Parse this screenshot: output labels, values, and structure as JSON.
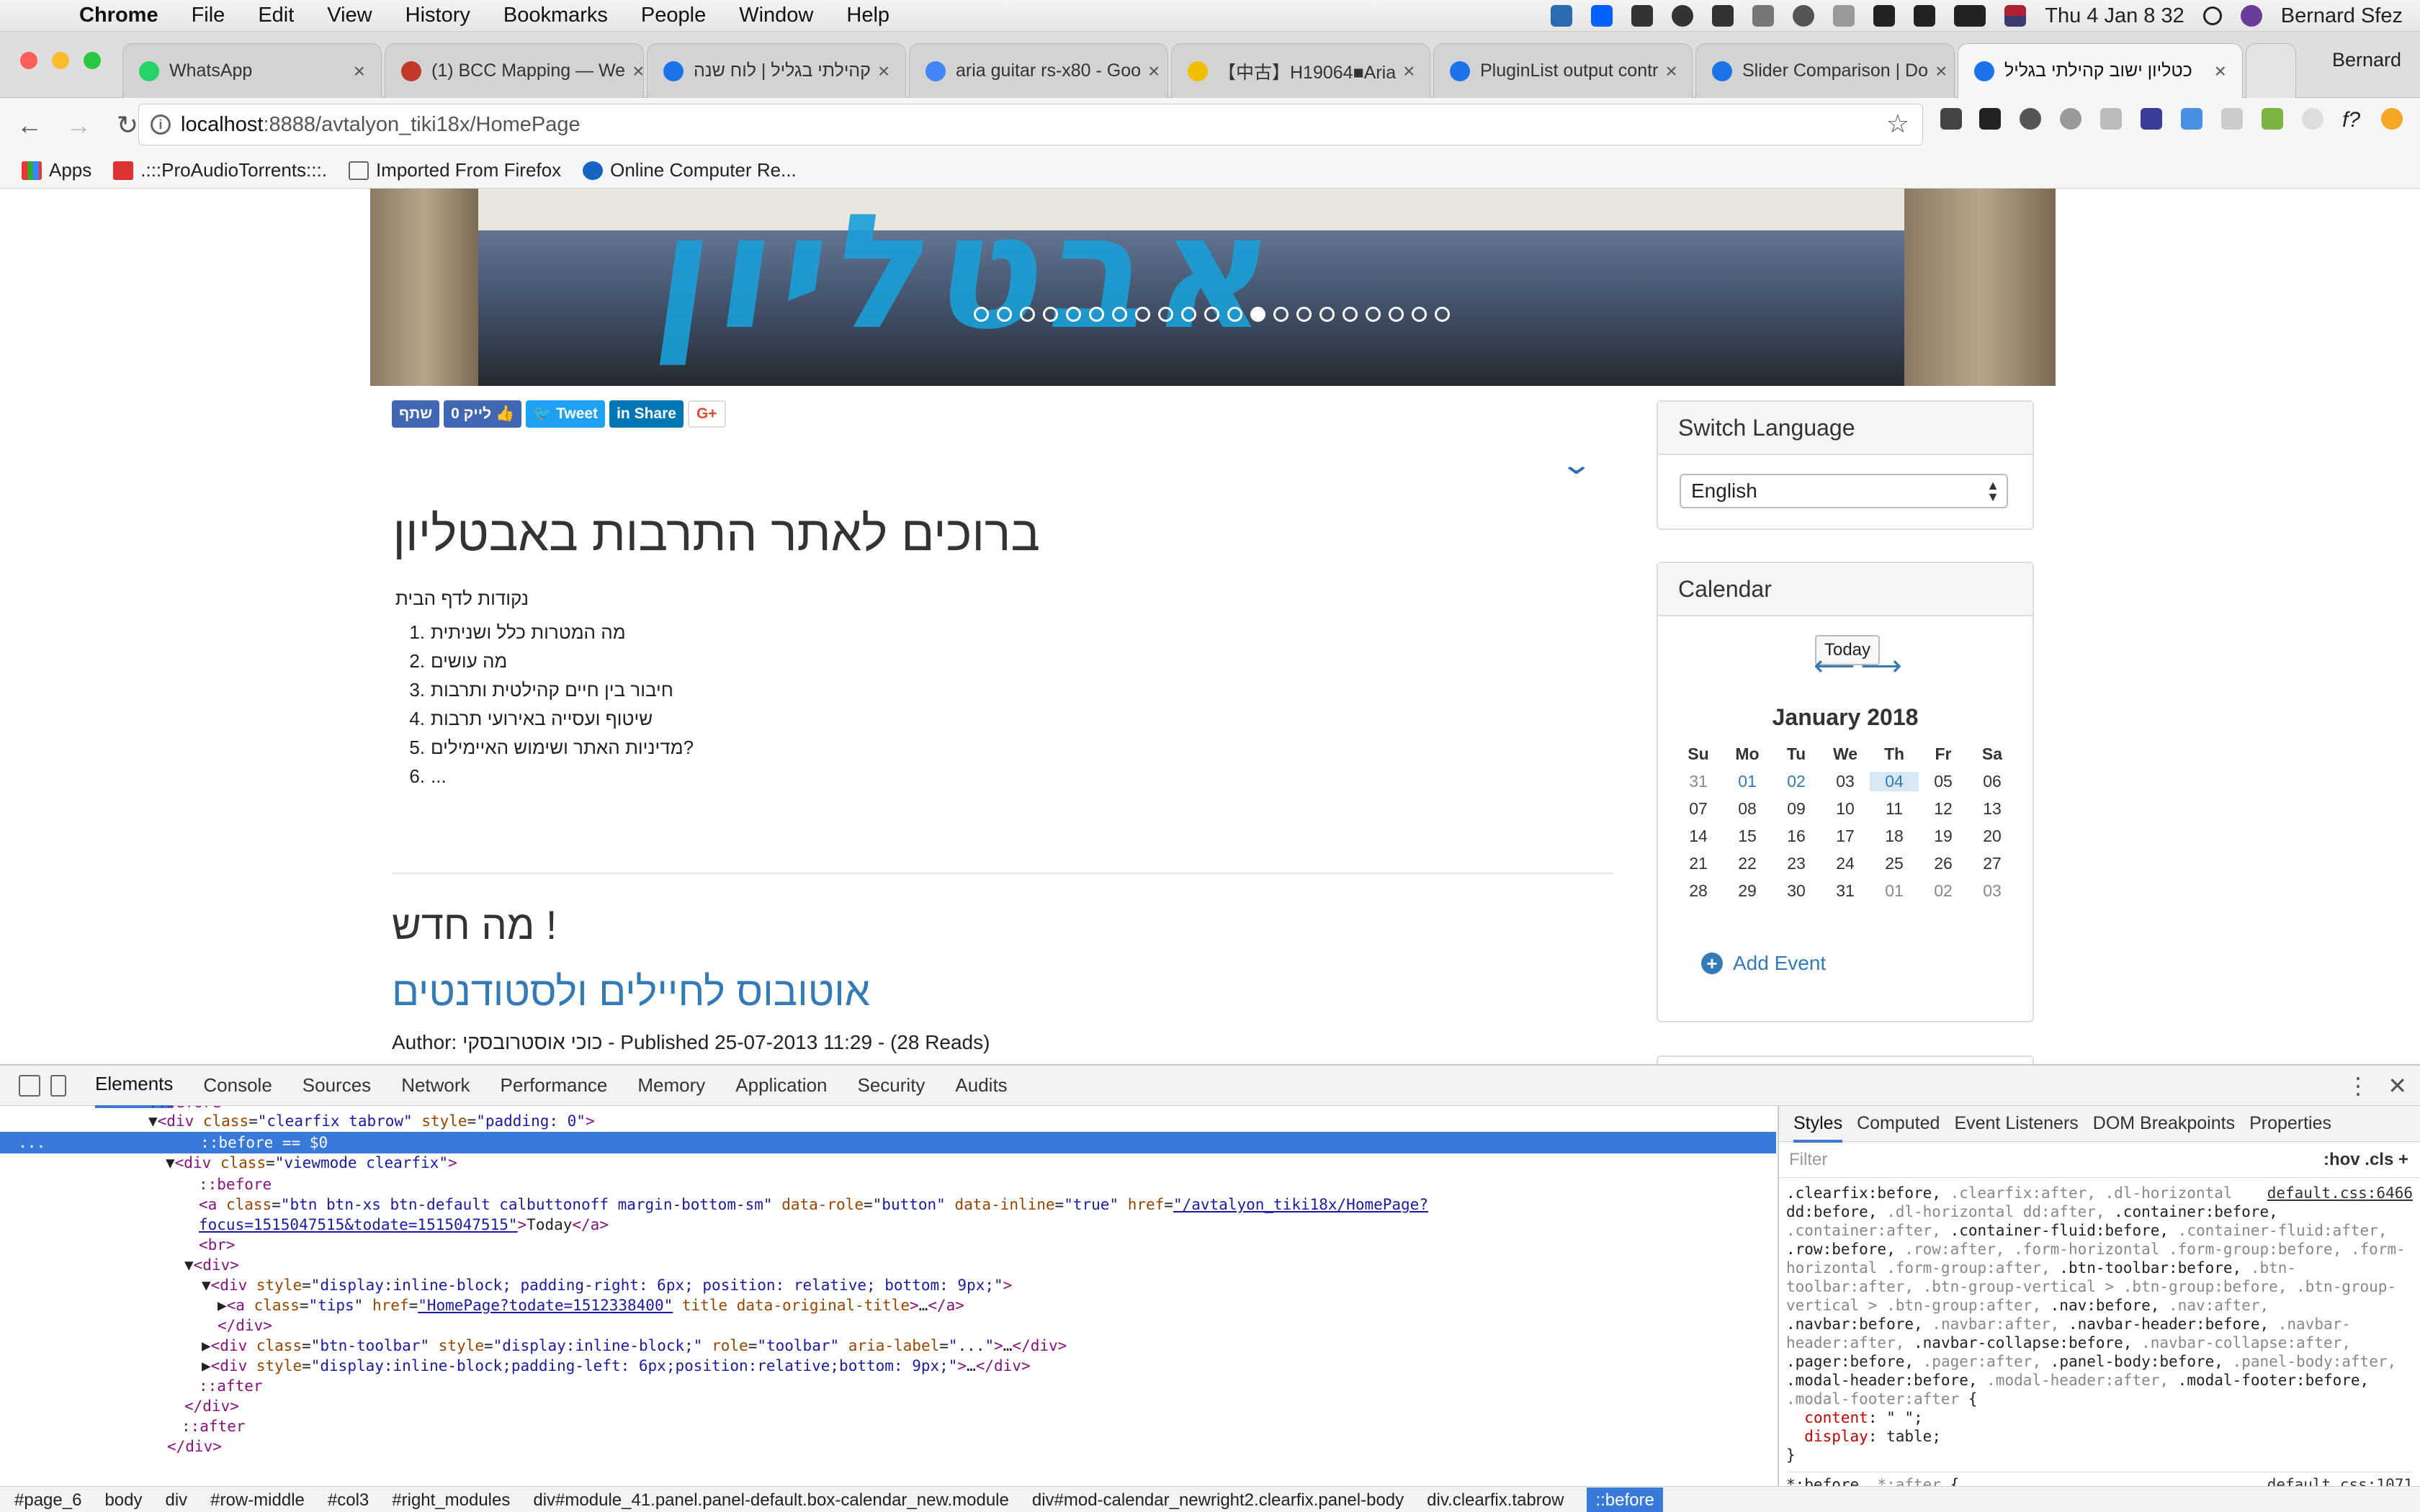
{
  "menubar": {
    "app": "Chrome",
    "items": [
      "File",
      "Edit",
      "View",
      "History",
      "Bookmarks",
      "People",
      "Window",
      "Help"
    ],
    "clock": "Thu 4 Jan  8 32",
    "user": "Bernard Sfez"
  },
  "tabs": [
    {
      "title": "WhatsApp",
      "color": "#25d366"
    },
    {
      "title": "(1) BCC Mapping — We",
      "color": "#c0392b"
    },
    {
      "title": "קהילתי בגליל | לוח שנה",
      "color": "#1a73e8"
    },
    {
      "title": "aria guitar rs-x80 - Goo",
      "color": "#4285f4"
    },
    {
      "title": "【中古】H19064■Aria",
      "color": "#f0c000"
    },
    {
      "title": "PluginList output contr",
      "color": "#1a73e8"
    },
    {
      "title": "Slider Comparison | Do",
      "color": "#1a73e8"
    },
    {
      "title": "כטליון ישוב קהילתי בגליל",
      "color": "#1a73e8"
    }
  ],
  "profile_name": "Bernard",
  "address": {
    "host": "localhost",
    "path": ":8888/avtalyon_tiki18x/HomePage"
  },
  "bookmarks": [
    ".:::ProAudioTorrents:::.",
    "Imported From Firefox",
    "Online Computer Re..."
  ],
  "bookmarks_apps": "Apps",
  "share": {
    "share_he": "שתף",
    "like_he": "לייק 0",
    "tweet": "Tweet",
    "linkedin": "Share",
    "gplus": "G+"
  },
  "main": {
    "title": "ברוכים לאתר התרבות באבטליון",
    "subtitle": "נקודות לדף הבית",
    "list": [
      "מה המטרות כלל ושניתית",
      "מה עושים",
      "חיבור בין חיים קהילטית ותרבות",
      "שיטוף ועסייה באירועי תרבות",
      "מדיניות האתר ושימוש האיימילים?",
      "..."
    ],
    "news_title": "מה חדש !",
    "article_title": "אוטובוס לחיילים ולסטודנטים",
    "article_meta": "Author: כוכי אוסטרובסקי - Published 25-07-2013 11:29 - (28 Reads)"
  },
  "language_panel": {
    "title": "Switch Language",
    "selected": "English"
  },
  "calendar": {
    "title": "Calendar",
    "today_label": "Today",
    "month": "January 2018",
    "weekdays": [
      "Su",
      "Mo",
      "Tu",
      "We",
      "Th",
      "Fr",
      "Sa"
    ],
    "weeks": [
      [
        "31",
        "01",
        "02",
        "03",
        "04",
        "05",
        "06"
      ],
      [
        "07",
        "08",
        "09",
        "10",
        "11",
        "12",
        "13"
      ],
      [
        "14",
        "15",
        "16",
        "17",
        "18",
        "19",
        "20"
      ],
      [
        "21",
        "22",
        "23",
        "24",
        "25",
        "26",
        "27"
      ],
      [
        "28",
        "29",
        "30",
        "31",
        "01",
        "02",
        "03"
      ]
    ],
    "add_event": "Add Event"
  },
  "devtools": {
    "tabs": [
      "Elements",
      "Console",
      "Sources",
      "Network",
      "Performance",
      "Memory",
      "Application",
      "Security",
      "Audits"
    ],
    "styles_tabs": [
      "Styles",
      "Computed",
      "Event Listeners",
      "DOM Breakpoints",
      "Properties"
    ],
    "filter_placeholder": "Filter",
    "filter_right": ":hov  .cls  +",
    "rule_source": "default.css:6466",
    "rule_source2": "default.css:1071",
    "breadcrumbs": [
      "#page_6",
      "body",
      "div",
      "#row-middle",
      "#col3",
      "#right_modules",
      "div#module_41.panel.panel-default.box-calendar_new.module",
      "div#mod-calendar_newright2.clearfix.panel-body",
      "div.clearfix.tabrow",
      "::before"
    ]
  },
  "slider_dots": {
    "count": 21,
    "active_index": 12
  }
}
